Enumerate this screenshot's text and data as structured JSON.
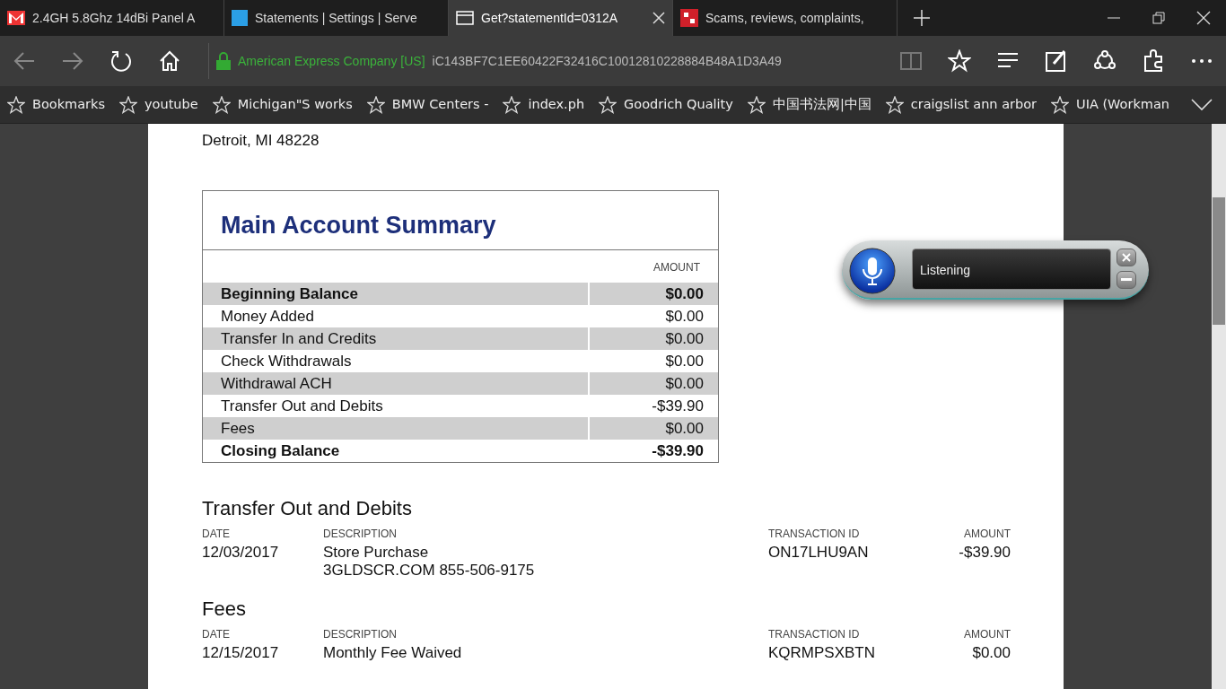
{
  "tabs": [
    {
      "title": "2.4GH 5.8Ghz 14dBi Panel A",
      "selected": false
    },
    {
      "title": "Statements | Settings | Serve",
      "selected": false
    },
    {
      "title": "Get?statementId=0312A",
      "selected": true
    },
    {
      "title": "Scams, reviews, complaints,",
      "selected": false
    }
  ],
  "address": {
    "site": "American Express Company [US]",
    "url": "iC143BF7C1EE60422F32416C10012810228884B48A1D3A49"
  },
  "bookmarks": [
    "Bookmarks",
    "youtube",
    "Michigan\"S works",
    "BMW Centers -",
    "index.ph",
    "Goodrich Quality",
    "中国书法网|中国",
    "craigslist ann arbor",
    "UIA (Workman"
  ],
  "address_lines": [
    "Detroit, MI 48228"
  ],
  "summary": {
    "title": "Main Account Summary",
    "column": "AMOUNT",
    "rows": [
      {
        "label": "Beginning Balance",
        "amount": "$0.00",
        "bold": true
      },
      {
        "label": "Money Added",
        "amount": "$0.00",
        "bold": false
      },
      {
        "label": "Transfer In and Credits",
        "amount": "$0.00",
        "bold": false
      },
      {
        "label": "Check Withdrawals",
        "amount": "$0.00",
        "bold": false
      },
      {
        "label": "Withdrawal ACH",
        "amount": "$0.00",
        "bold": false
      },
      {
        "label": "Transfer Out and Debits",
        "amount": "-$39.90",
        "bold": false
      },
      {
        "label": "Fees",
        "amount": "$0.00",
        "bold": false
      },
      {
        "label": "Closing Balance",
        "amount": "-$39.90",
        "bold": true
      }
    ]
  },
  "sections": [
    {
      "title": "Transfer Out and Debits",
      "columns": [
        "DATE",
        "DESCRIPTION",
        "TRANSACTION ID",
        "AMOUNT"
      ],
      "rows": [
        {
          "date": "12/03/2017",
          "description": [
            "Store Purchase",
            "3GLDSCR.COM 855-506-9175"
          ],
          "transaction_id": "ON17LHU9AN",
          "amount": "-$39.90"
        }
      ]
    },
    {
      "title": "Fees",
      "columns": [
        "DATE",
        "DESCRIPTION",
        "TRANSACTION ID",
        "AMOUNT"
      ],
      "rows": [
        {
          "date": "12/15/2017",
          "description": [
            "Monthly Fee Waived"
          ],
          "transaction_id": "KQRMPSXBTN",
          "amount": "$0.00"
        }
      ]
    }
  ],
  "speech": {
    "status": "Listening"
  }
}
